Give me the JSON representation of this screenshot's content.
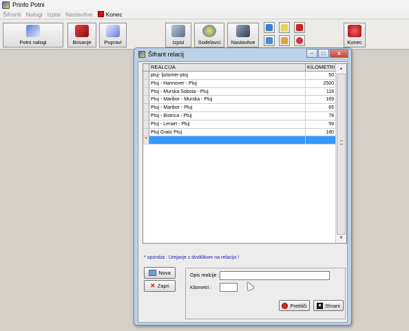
{
  "app": {
    "title": "Prinfo Potni"
  },
  "menu": {
    "items": [
      "Šifranti",
      "Nalogi",
      "Izpisi",
      "Nastavitve"
    ],
    "exit_label": "Konec"
  },
  "toolbar": {
    "potni_nalogi": "Potni nalogi",
    "brisanje": "Brisanje",
    "popravi": "Popravi",
    "izpisi": "Izpisi",
    "sodelavci": "Sodelavci",
    "nastavitve": "Nastavitve",
    "konec": "Konec"
  },
  "dialog": {
    "title": "Šifrant relacij",
    "columns": {
      "relation": "REALCIJA",
      "km": "KILOMETRI"
    },
    "rows": [
      {
        "relation": "ptuj- ljutomer-ptuj",
        "km": "50"
      },
      {
        "relation": "Ptuj - Hannover - Ptuj",
        "km": "2500"
      },
      {
        "relation": "Ptuj - Murska Sobota - Ptuj",
        "km": "118"
      },
      {
        "relation": "Ptuj - Maribor - Murska - Ptuj",
        "km": "169"
      },
      {
        "relation": "Ptuj - Maribor - Ptuj",
        "km": "65"
      },
      {
        "relation": "Ptuj - Bistrica - Ptuj",
        "km": "78"
      },
      {
        "relation": "Ptuj - Lenart - Ptuj",
        "km": "59"
      },
      {
        "relation": "Ptuj Gratz Ptuj",
        "km": "180"
      }
    ],
    "new_row_marker": "*",
    "note": "* opomba :  Urejanje z dvoklikom na relacijo !",
    "buttons": {
      "nova": "Nova",
      "zapri": "Zapri",
      "preklici": "Prekliči",
      "shrani": "Shrani"
    },
    "form": {
      "opis_label": "Opis realcije :",
      "km_label": "Kilometri :",
      "opis_value": "",
      "km_value": ""
    }
  }
}
